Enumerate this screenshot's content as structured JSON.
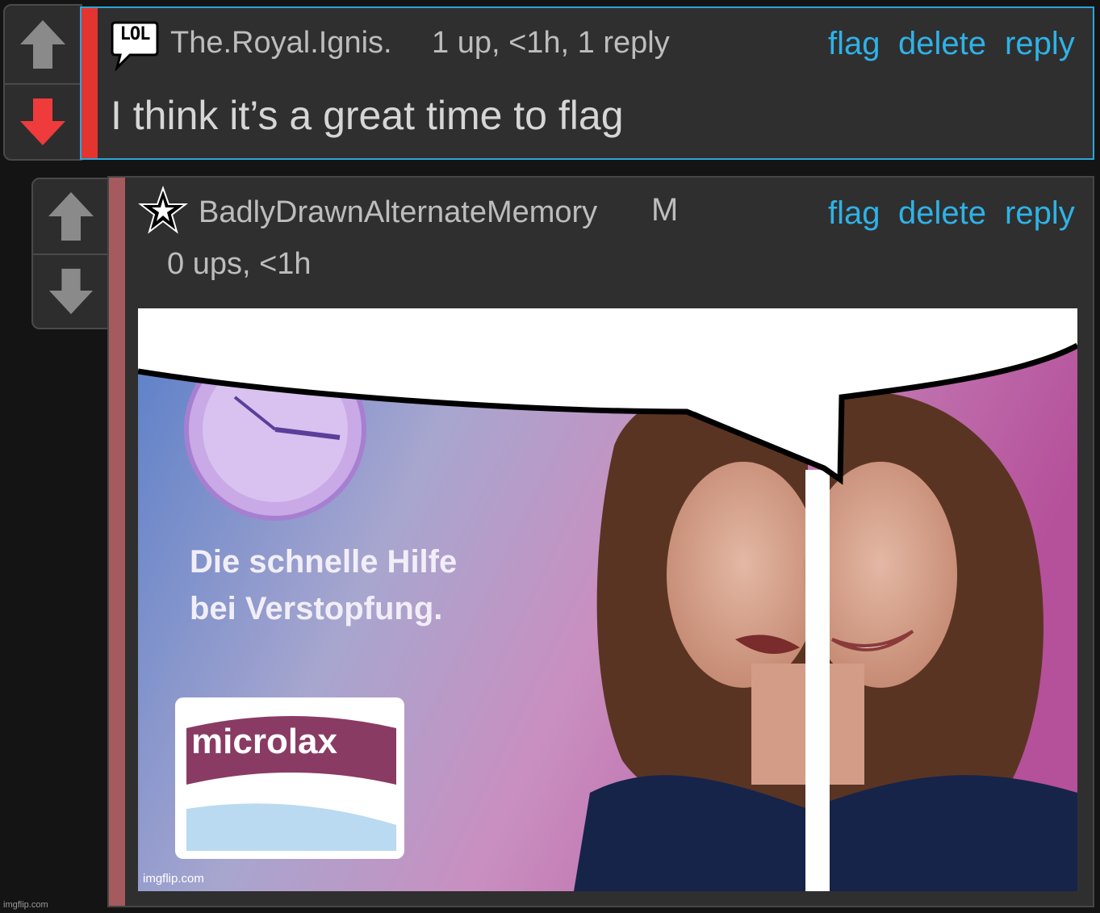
{
  "comments": [
    {
      "username": "The.Royal.Ignis.",
      "badge": "LOL",
      "meta": "1 up, <1h, 1 reply",
      "actions": {
        "flag": "flag",
        "delete": "delete",
        "reply": "reply"
      },
      "text": "I think it’s a great time to flag",
      "vote_state": "downvoted",
      "accent_color": "#e3342f"
    },
    {
      "username": "BadlyDrawnAlternateMemory",
      "mod_badge": "M",
      "meta": "0 ups, <1h",
      "actions": {
        "flag": "flag",
        "delete": "delete",
        "reply": "reply"
      },
      "vote_state": "none",
      "accent_color": "#a55a5e",
      "image": {
        "headline_line1": "Die schnelle Hilfe",
        "headline_line2": "bei Verstopfung.",
        "product": "microlax",
        "watermark": "imgflip.com"
      }
    }
  ],
  "site_watermark": "imgflip.com",
  "colors": {
    "link": "#2fb2e6",
    "downvote": "#ef3b3b",
    "selected_border": "#2aa6dc"
  }
}
